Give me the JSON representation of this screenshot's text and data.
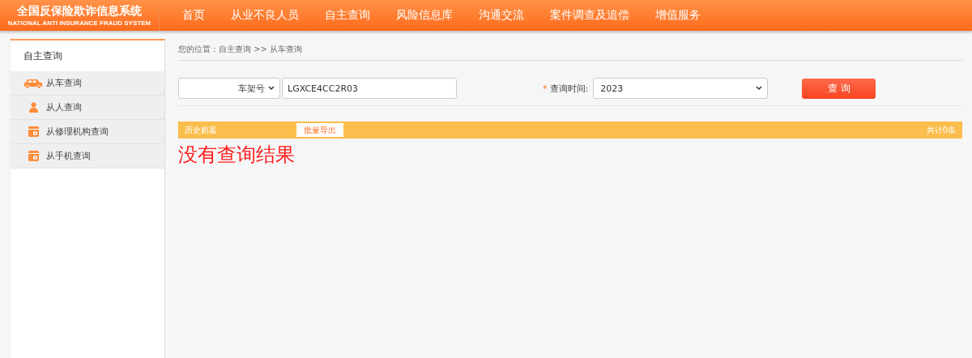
{
  "header": {
    "logo_title": "全国反保险欺诈信息系统",
    "logo_subtitle": "NATIONAL ANTI INSURANCE FRAUD SYSTEM",
    "nav": [
      "首页",
      "从业不良人员",
      "自主查询",
      "风险信息库",
      "沟通交流",
      "案件调查及追偿",
      "增值服务"
    ]
  },
  "sidebar": {
    "title": "自主查询",
    "items": [
      {
        "label": "从车查询",
        "kind": "car"
      },
      {
        "label": "从人查询",
        "kind": "person"
      },
      {
        "label": "从修理机构查询",
        "kind": "shop"
      },
      {
        "label": "从手机查询",
        "kind": "shop"
      }
    ]
  },
  "breadcrumb": "您的位置：自主查询 >> 从车查询",
  "form": {
    "id_type": "车架号",
    "id_value": "LGXCE4CC2R03",
    "required_mark": "*",
    "time_label": "查询时间:",
    "time_value": "2023",
    "submit": "查 询"
  },
  "results": {
    "title": "历史赔案",
    "export": "批量导出",
    "count": "共计0条",
    "empty": "没有查询结果"
  }
}
